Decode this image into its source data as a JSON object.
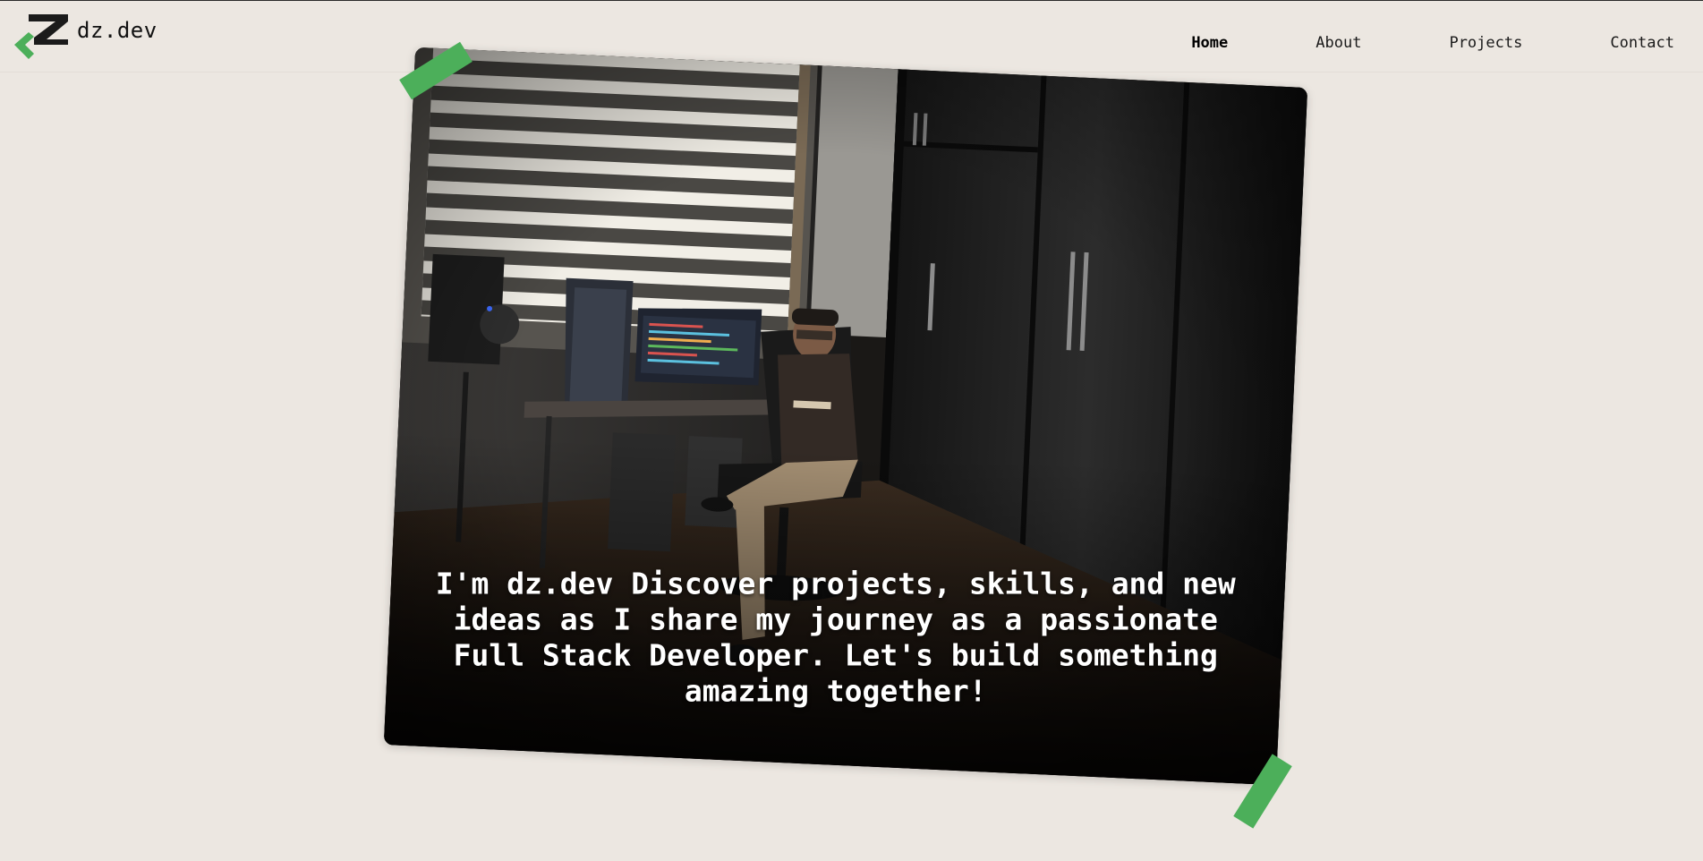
{
  "brand": {
    "name": "dz.dev",
    "logo_icon": "dz-logo-icon",
    "accent_color": "#4caf5a"
  },
  "nav": {
    "items": [
      {
        "label": "Home",
        "active": true
      },
      {
        "label": "About",
        "active": false
      },
      {
        "label": "Projects",
        "active": false
      },
      {
        "label": "Contact",
        "active": false
      }
    ]
  },
  "hero": {
    "image_alt": "Developer sitting in a chair next to a desk with monitors in a dark room",
    "tagline": "I'm dz.dev Discover projects, skills, and new ideas as I share my journey as a passionate Full Stack Developer. Let's build something amazing together!"
  },
  "colors": {
    "background": "#ece7e1",
    "text": "#111111",
    "tape": "#4caf5a"
  }
}
